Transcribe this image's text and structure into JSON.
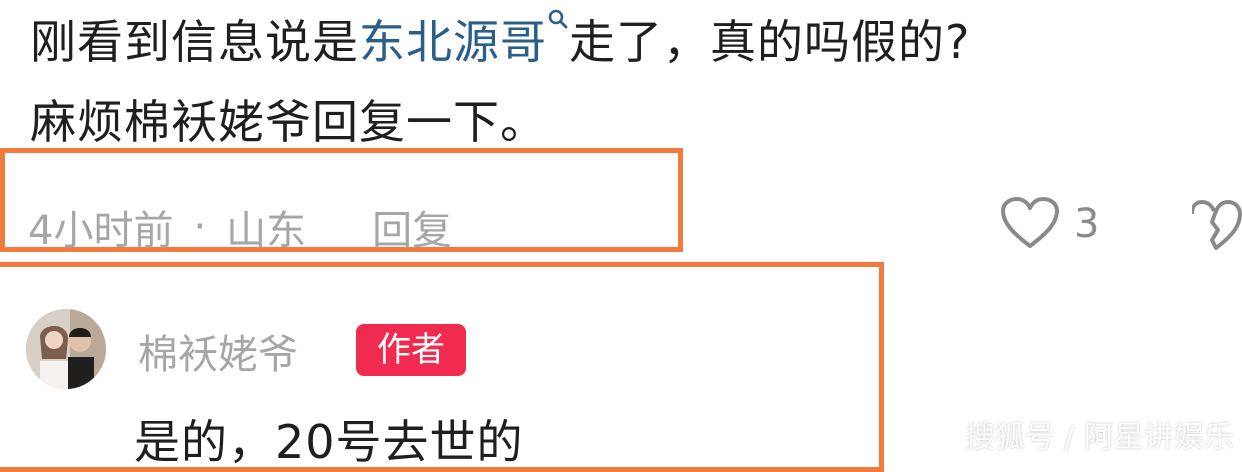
{
  "comment": {
    "line1_before": "刚看到信息说是",
    "mention": "东北源哥",
    "line1_after": "走了，真的吗假的?",
    "line2": "麻烦棉袄姥爷回复一下。",
    "time": "4小时前",
    "separator": "·",
    "location": "山东",
    "reply_label": "回复",
    "like_count": "3"
  },
  "reply": {
    "username": "棉袄姥爷",
    "badge": "作者",
    "text": "是的，20号去世的"
  },
  "watermark": "搜狐号 / 阿星讲娱乐",
  "colors": {
    "highlight_border": "#f27a3c",
    "mention": "#2b5f8a",
    "author_badge": "#f02b4f",
    "meta_text": "#a6a6a6"
  },
  "icons": {
    "mention": "search-icon",
    "like": "heart-outline-icon",
    "dislike": "broken-heart-icon"
  }
}
